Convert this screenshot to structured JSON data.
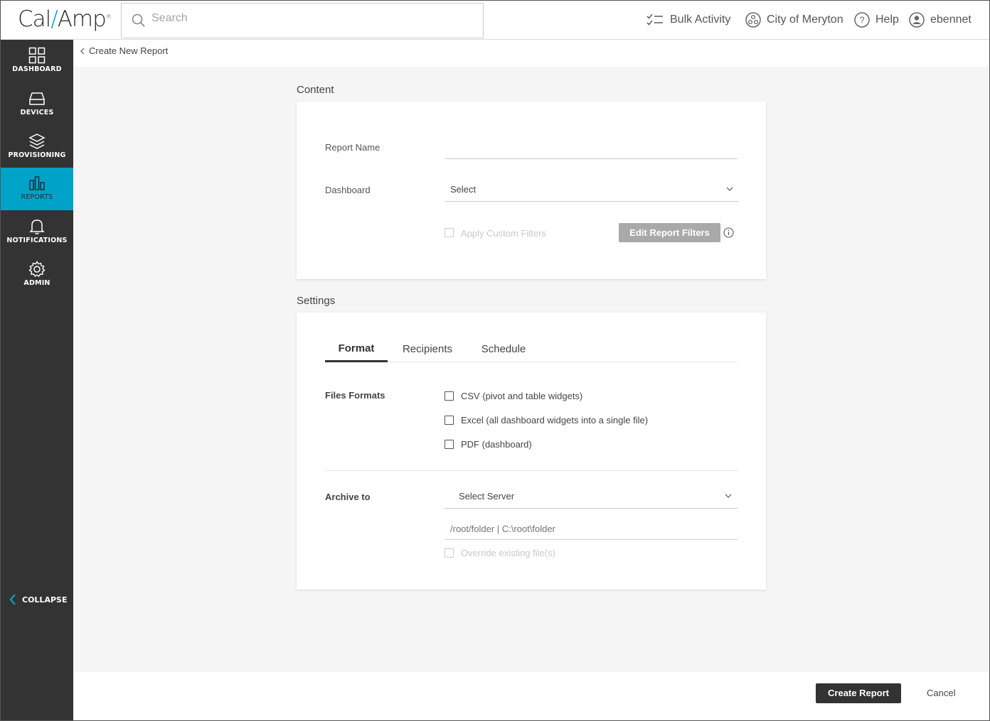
{
  "header": {
    "logo_text_a": "Cal",
    "logo_slash": "/",
    "logo_text_b": "Amp",
    "logo_mark": "®",
    "search_placeholder": "Search",
    "bulk_activity": "Bulk Activity",
    "organization": "City of Meryton",
    "help": "Help",
    "user": "ebennet"
  },
  "sidebar": {
    "items": [
      {
        "label": "DASHBOARD",
        "icon": "dashboard-icon"
      },
      {
        "label": "DEVICES",
        "icon": "devices-icon"
      },
      {
        "label": "PROVISIONING",
        "icon": "layers-icon"
      },
      {
        "label": "REPORTS",
        "icon": "reports-icon",
        "active": true
      },
      {
        "label": "NOTIFICATIONS",
        "icon": "bell-icon"
      },
      {
        "label": "ADMIN",
        "icon": "gear-icon"
      }
    ],
    "collapse_label": "COLLAPSE",
    "active_color": "#00a3c8"
  },
  "breadcrumb": {
    "label": "Create New Report"
  },
  "content": {
    "section_title": "Content",
    "report_name_label": "Report Name",
    "report_name_value": "",
    "dashboard_label": "Dashboard",
    "dashboard_value": "Select",
    "apply_custom_filters_label": "Apply Custom Filters",
    "edit_filters_button": "Edit Report Filters"
  },
  "settings": {
    "section_title": "Settings",
    "tabs": [
      {
        "label": "Format",
        "active": true
      },
      {
        "label": "Recipients"
      },
      {
        "label": "Schedule"
      }
    ],
    "file_formats_label": "Files Formats",
    "formats": [
      {
        "label": "CSV (pivot and table widgets)",
        "checked": false
      },
      {
        "label": "Excel (all dashboard widgets into a single file)",
        "checked": false
      },
      {
        "label": "PDF (dashboard)",
        "checked": false
      }
    ],
    "archive_label": "Archive to",
    "server_select": "Select Server",
    "path_placeholder": "/root/folder | C:\\root\\folder",
    "override_label": "Override existing file(s)"
  },
  "footer": {
    "create_button": "Create Report",
    "cancel_button": "Cancel"
  }
}
